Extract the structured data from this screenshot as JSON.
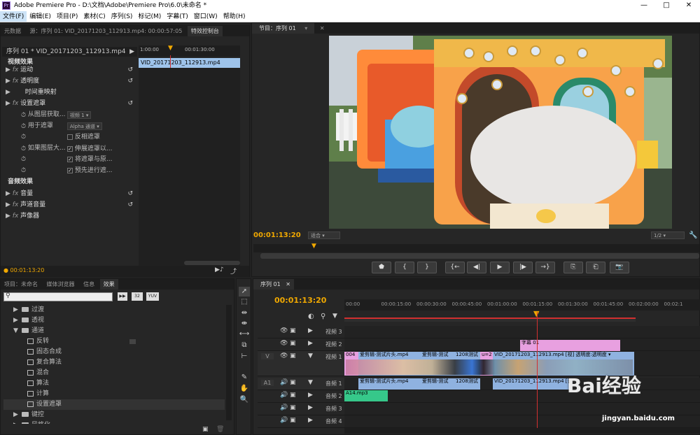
{
  "window": {
    "title": "Adobe Premiere Pro - D:\\文档\\Adobe\\Premiere Pro\\6.0\\未命名 *",
    "logo": "Pr",
    "controls": [
      "—",
      "□",
      "✕"
    ]
  },
  "menu": [
    "文件(F)",
    "编辑(E)",
    "项目(P)",
    "素材(C)",
    "序列(S)",
    "标记(M)",
    "字幕(T)",
    "窗口(W)",
    "帮助(H)"
  ],
  "effect_controls": {
    "tabs": [
      "元数据",
      "源：序列 01: VID_20171203_112913.mp4: 00:00:57:05",
      "特效控制台"
    ],
    "header": "序列 01 * VID_20171203_112913.mp4",
    "ruler": [
      "1:00:00",
      "00:01:30:00"
    ],
    "clip_name": "VID_20171203_112913.mp4",
    "video_effects_label": "视频效果",
    "video_items": [
      {
        "label": "运动",
        "fx": true,
        "reset": true
      },
      {
        "label": "透明度",
        "fx": true,
        "reset": true
      },
      {
        "label": "时间重映射",
        "fx": false,
        "reset": false
      },
      {
        "label": "设置遮罩",
        "fx": true,
        "reset": true
      }
    ],
    "params": [
      {
        "label": "从图层获取...",
        "value": "视频 1",
        "type": "dropdown"
      },
      {
        "label": "用于遮罩",
        "value": "Alpha 通道",
        "type": "dropdown"
      },
      {
        "label": "",
        "value": "反相遮罩",
        "type": "check",
        "checked": false
      },
      {
        "label": "如果图层大...",
        "value": "伸展遮罩以...",
        "type": "check",
        "checked": true
      },
      {
        "label": "",
        "value": "将遮罩与原...",
        "type": "check",
        "checked": true
      },
      {
        "label": "",
        "value": "预先进行遮...",
        "type": "check",
        "checked": true
      }
    ],
    "audio_effects_label": "音频效果",
    "audio_items": [
      {
        "label": "音量",
        "reset": true
      },
      {
        "label": "声道音量",
        "reset": true
      },
      {
        "label": "声像器",
        "reset": false
      }
    ],
    "timecode": "00:01:13:20"
  },
  "program": {
    "tab": "节目：序列 01",
    "timecode": "00:01:13:20",
    "fit": "适合",
    "ratio": "1/2",
    "controls": [
      "⬟",
      "{",
      "}",
      "{←",
      "◀|",
      "▶",
      "|▶",
      "→}",
      "⎘",
      "⎗",
      "📷"
    ]
  },
  "project": {
    "tabs": [
      "项目：未命名",
      "媒体浏览器",
      "信息",
      "效果"
    ],
    "search_placeholder": "",
    "badges": [
      "▶▶",
      "32",
      "YUV"
    ],
    "tree": [
      {
        "label": "过渡",
        "type": "folder",
        "indent": 1,
        "open": false
      },
      {
        "label": "透视",
        "type": "folder",
        "indent": 1,
        "open": false
      },
      {
        "label": "通道",
        "type": "folder",
        "indent": 1,
        "open": true
      },
      {
        "label": "反转",
        "type": "preset",
        "indent": 2
      },
      {
        "label": "固态合成",
        "type": "preset",
        "indent": 2
      },
      {
        "label": "复合算法",
        "type": "preset",
        "indent": 2
      },
      {
        "label": "混合",
        "type": "preset",
        "indent": 2
      },
      {
        "label": "算法",
        "type": "preset",
        "indent": 2
      },
      {
        "label": "计算",
        "type": "preset",
        "indent": 2
      },
      {
        "label": "设置遮罩",
        "type": "preset",
        "indent": 2,
        "selected": true
      },
      {
        "label": "键控",
        "type": "folder",
        "indent": 1,
        "open": false
      },
      {
        "label": "风格化",
        "type": "folder",
        "indent": 1,
        "open": false
      }
    ]
  },
  "tools": [
    "➚",
    "⬚",
    "⇹",
    "⇼",
    "⟷",
    "⧉",
    "⊢",
    "✎",
    "✋",
    "🔍"
  ],
  "timeline": {
    "tab": "序列 01",
    "timecode": "00:01:13:20",
    "ruler": [
      "00:00",
      "00:00:15:00",
      "00:00:30:00",
      "00:00:45:00",
      "00:01:00:00",
      "00:01:15:00",
      "00:01:30:00",
      "00:01:45:00",
      "00:02:00:00",
      "00:02:1"
    ],
    "tracks": [
      {
        "name": "视频 3",
        "kind": "video"
      },
      {
        "name": "视频 2",
        "kind": "video"
      },
      {
        "name": "视频 1",
        "kind": "video",
        "target": "V"
      },
      {
        "name": "音频 1",
        "kind": "audio",
        "target": "A1"
      },
      {
        "name": "音频 2",
        "kind": "audio"
      },
      {
        "name": "音频 3",
        "kind": "audio"
      },
      {
        "name": "音频 4",
        "kind": "audio"
      }
    ],
    "clips": {
      "title": "字幕 01",
      "v1": [
        "004",
        "爱剪辑-测试片头.mp4",
        "爱剪辑-测试",
        "1208测试",
        "u=2",
        "VID_20171203_112913.mp4 [视] 透明度:透明度 ▾"
      ],
      "a1": [
        "爱剪辑-测试片头.mp4",
        "爱剪辑-测试",
        "1208测试",
        "VID_20171203_112913.mp4 [音]"
      ],
      "a2": "A14.mp3"
    }
  },
  "watermark": {
    "brand": "Bai经验",
    "url": "jingyan.baidu.com"
  },
  "colors": {
    "accent": "#f0a800",
    "playhead": "#d23030",
    "clip_blue": "#8fb2e0",
    "clip_pink": "#e8a0e0",
    "clip_green": "#36c88a"
  }
}
